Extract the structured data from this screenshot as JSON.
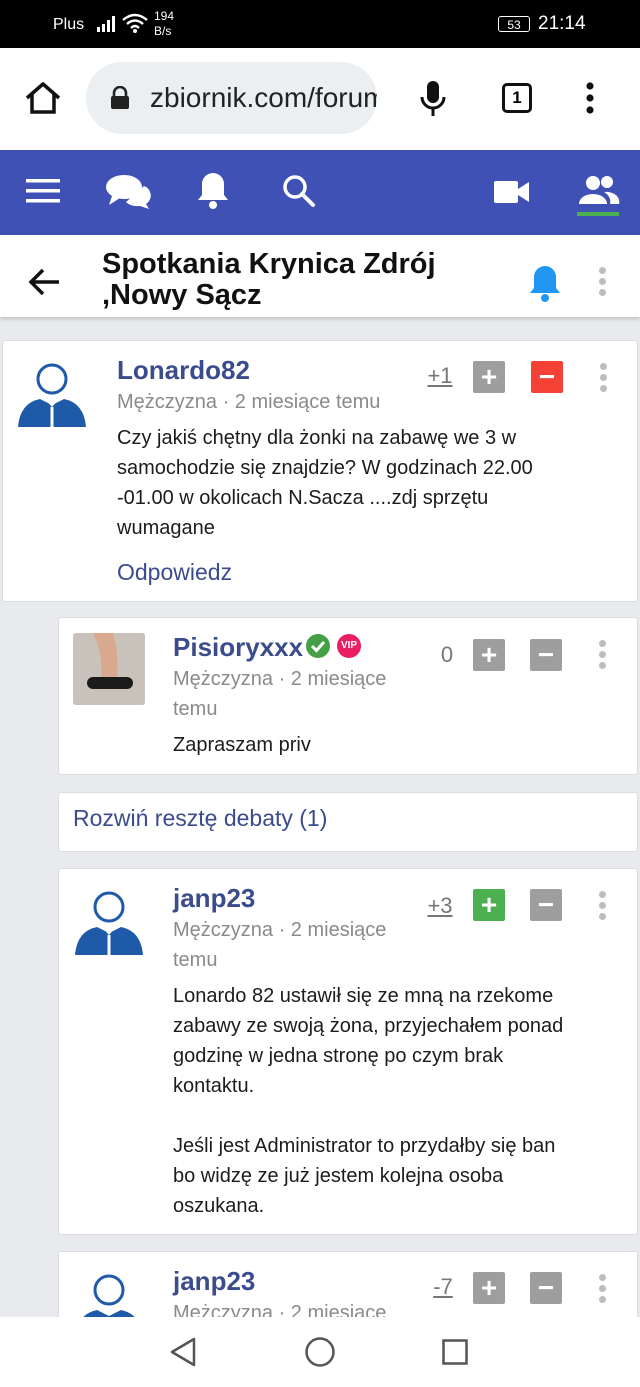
{
  "status_bar": {
    "carrier": "Plus",
    "speed_value": "194",
    "speed_unit": "B/s",
    "battery": "53",
    "time": "21:14"
  },
  "browser": {
    "url": "zbiornik.com/forum",
    "tab_count": "1"
  },
  "page": {
    "title_line1": "Spotkania Krynica Zdrój",
    "title_line2": ",Nowy Sącz"
  },
  "posts": [
    {
      "username": "Lonardo82",
      "meta_line1": "Mężczyzna · 2 miesiące temu",
      "meta_line2": "",
      "score": "+1",
      "body_lines": [
        "Czy jakiś chętny dla żonki na zabawę we 3 w",
        "samochodzie się znajdzie? W godzinach 22.00",
        "-01.00 w okolicach N.Sacza ....zdj sprzętu",
        "wumagane"
      ],
      "reply_label": "Odpowiedz"
    },
    {
      "username": "Pisioryxxx",
      "vip_label": "VIP",
      "meta_line1": "Mężczyzna · 2 miesiące",
      "meta_line2": "temu",
      "score": "0",
      "body_lines": [
        "Zapraszam priv"
      ]
    },
    {
      "username": "janp23",
      "meta_line1": "Mężczyzna · 2 miesiące",
      "meta_line2": "temu",
      "score": "+3",
      "body_lines": [
        "Lonardo 82 ustawił się ze mną na rzekome",
        "zabawy ze swoją żona, przyjechałem ponad",
        "godzinę w jedna stronę po czym brak",
        "kontaktu.",
        "",
        "Jeśli jest Administrator to przydałby się ban",
        "bo widzę ze już jestem kolejna osoba",
        "oszukana."
      ]
    },
    {
      "username": "janp23",
      "meta_line1": "Mężczyzna · 2 miesiące",
      "score": "-7"
    }
  ],
  "expand_label": "Rozwiń resztę debaty (1)",
  "colors": {
    "navbar": "#3f51b5",
    "link": "#3b4c8c",
    "upvote_active": "#4caf50",
    "downvote_active": "#f44336",
    "bell_blue": "#2196f3"
  }
}
